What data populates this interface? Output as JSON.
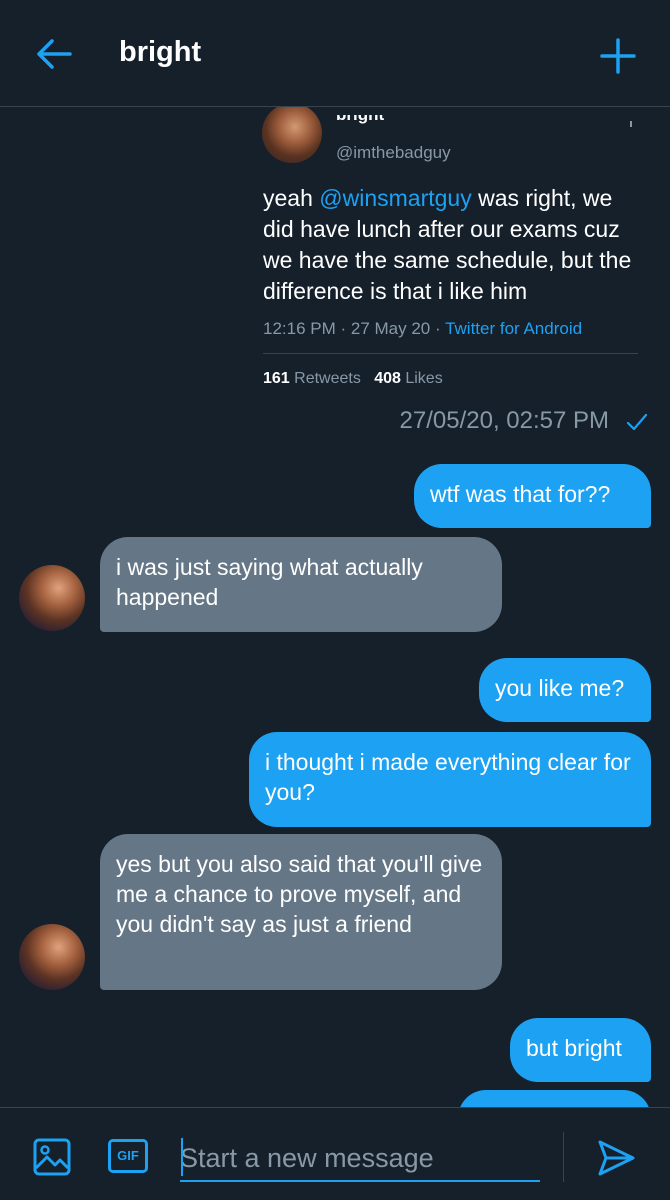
{
  "header": {
    "title": "bright",
    "back_icon": "arrow-left-icon",
    "action_icon": "plus-icon"
  },
  "tweet": {
    "name": "bright",
    "handle": "@imthebadguy",
    "text_before": "yeah ",
    "mention": "@winsmartguy",
    "text_after": " was right, we did have lunch after our exams cuz we have the same schedule, but the difference is that i like him",
    "time_date": "12:16 PM · 27 May 20 · ",
    "source": "Twitter for Android",
    "retweets_count": "161",
    "retweets_label": " Retweets",
    "likes_count": "408",
    "likes_label": " Likes"
  },
  "tweet_timestamp": "27/05/20, 02:57 PM",
  "messages": [
    {
      "dir": "out",
      "text": "wtf was that for??"
    },
    {
      "dir": "in",
      "text": "i was just saying what actually happened"
    },
    {
      "dir": "out",
      "text": "you like me?"
    },
    {
      "dir": "out",
      "text": "i thought i made everything clear for you?"
    },
    {
      "dir": "in",
      "text": "yes but you also said that you'll give me a chance to prove myself, and you didn't say as just a friend"
    },
    {
      "dir": "out",
      "text": "but bright"
    }
  ],
  "composer": {
    "placeholder": "Start a new message",
    "gif_label": "GIF"
  },
  "colors": {
    "background": "#15202b",
    "accent": "#1da1f2",
    "incoming_bubble": "#657786",
    "muted_text": "#8899a6",
    "divider": "#38444d"
  }
}
